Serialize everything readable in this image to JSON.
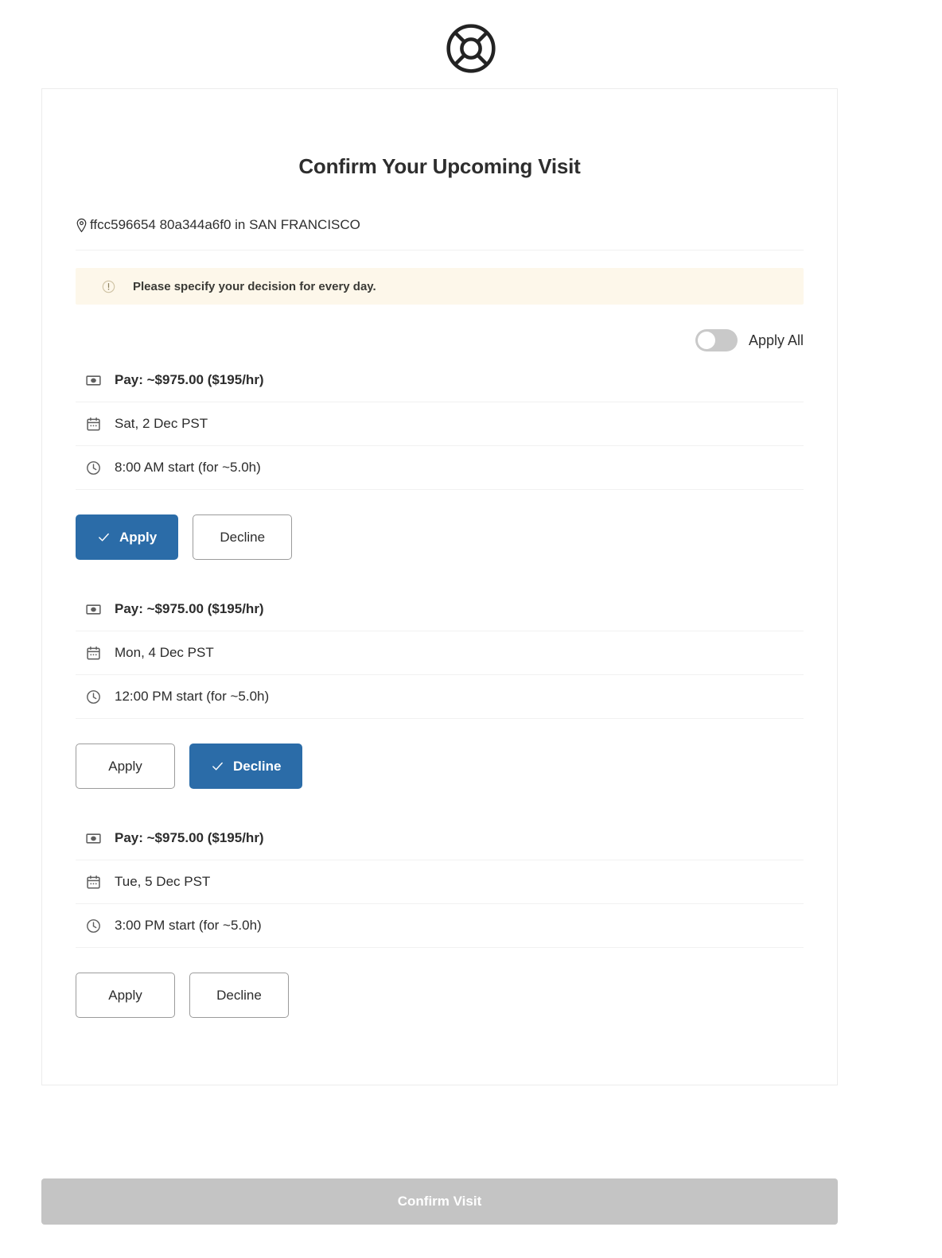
{
  "brand": {
    "logo_icon": "life-buoy-icon"
  },
  "page": {
    "title": "Confirm Your Upcoming Visit"
  },
  "location": {
    "icon": "map-pin-icon",
    "text": "ffcc596654 80a344a6f0 in SAN FRANCISCO"
  },
  "alert": {
    "icon": "exclamation-circle-icon",
    "message": "Please specify your decision for every day.",
    "background_color": "#fdf7ea"
  },
  "apply_all": {
    "label": "Apply All",
    "enabled": false
  },
  "labels": {
    "pay_icon": "banknote-icon",
    "date_icon": "calendar-icon",
    "time_icon": "clock-icon",
    "apply": "Apply",
    "decline": "Decline"
  },
  "shifts": [
    {
      "pay": "Pay: ~$975.00 ($195/hr)",
      "date": "Sat, 2 Dec PST",
      "time": "8:00 AM start (for ~5.0h)",
      "apply_label": "Apply",
      "decline_label": "Decline",
      "selection": "apply"
    },
    {
      "pay": "Pay: ~$975.00 ($195/hr)",
      "date": "Mon, 4 Dec PST",
      "time": "12:00 PM start (for ~5.0h)",
      "apply_label": "Apply",
      "decline_label": "Decline",
      "selection": "decline"
    },
    {
      "pay": "Pay: ~$975.00 ($195/hr)",
      "date": "Tue, 5 Dec PST",
      "time": "3:00 PM start (for ~5.0h)",
      "apply_label": "Apply",
      "decline_label": "Decline",
      "selection": "none"
    }
  ],
  "footer": {
    "confirm_label": "Confirm Visit",
    "confirm_disabled": true,
    "confirm_color": "#c4c4c4"
  },
  "colors": {
    "primary_blue": "#2b6ca8",
    "card_border": "#ececec",
    "divider": "#f1f1f1"
  }
}
